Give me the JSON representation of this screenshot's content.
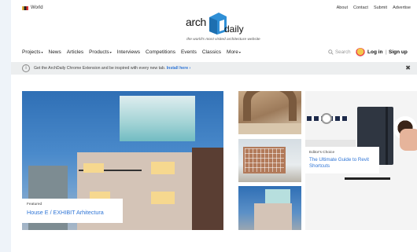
{
  "topbar": {
    "region": "World",
    "links": [
      "About",
      "Contact",
      "Submit",
      "Advertise"
    ]
  },
  "logo": {
    "part1": "arch",
    "part2": "daily",
    "tagline": "the world's most visited architecture website"
  },
  "nav": {
    "items": [
      {
        "label": "Projects",
        "caret": true
      },
      {
        "label": "News",
        "caret": false
      },
      {
        "label": "Articles",
        "caret": false
      },
      {
        "label": "Products",
        "caret": true
      },
      {
        "label": "Interviews",
        "caret": false
      },
      {
        "label": "Competitions",
        "caret": false
      },
      {
        "label": "Events",
        "caret": false
      },
      {
        "label": "Classics",
        "caret": false
      },
      {
        "label": "More",
        "caret": true
      }
    ],
    "search_placeholder": "Search",
    "login": "Log in",
    "separator": "|",
    "signup": "Sign up"
  },
  "banner": {
    "message": "Get the ArchDaily Chrome Extension and be inspired with every new tab.",
    "link": "Install here ›",
    "close": "✖"
  },
  "featured": {
    "tag": "Featured",
    "title": "House E / EXHIBIT Arhitectura"
  },
  "editors_choice": {
    "tag": "Editor's Choice",
    "title": "The Ultimate Guide to Revit Shortcuts"
  },
  "colors": {
    "accent": "#2f75d6",
    "logo_blue": "#2f8fd6"
  },
  "icons": {
    "search": "search-icon",
    "info": "info-icon",
    "close": "close-icon",
    "caret": "chevron-down-icon"
  }
}
